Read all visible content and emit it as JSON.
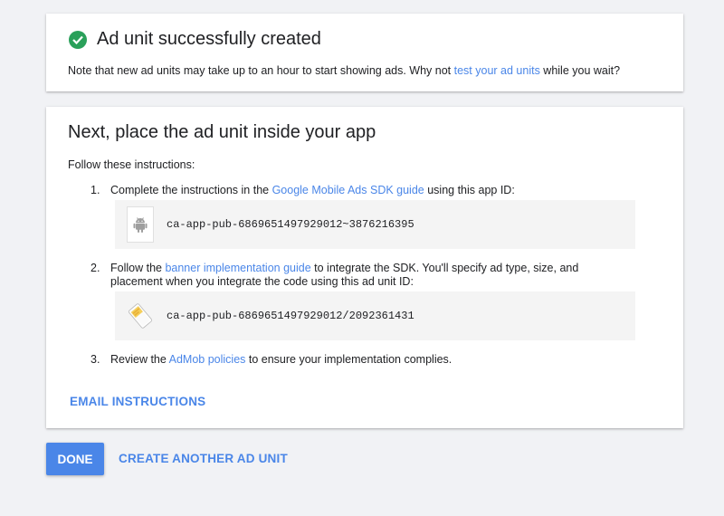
{
  "success_card": {
    "title": "Ad unit successfully created",
    "note_before": "Note that new ad units may take up to an hour to start showing ads.  Why not ",
    "note_link": "test your ad units",
    "note_after": " while you wait?"
  },
  "place_card": {
    "title": "Next, place the ad unit inside your app",
    "follow": "Follow these instructions:",
    "steps": [
      {
        "num": "1.",
        "before": "Complete the instructions in the ",
        "link": "Google Mobile Ads SDK guide",
        "after": " using this app ID:"
      },
      {
        "num": "2.",
        "before": "Follow the ",
        "link": "banner implementation guide",
        "after": " to integrate the SDK. You'll specify ad type, size, and placement when you integrate the code using this ad unit ID:"
      },
      {
        "num": "3.",
        "before": "Review the ",
        "link": "AdMob policies",
        "after": " to ensure your implementation complies."
      }
    ],
    "app_id": "ca-app-pub-6869651497929012~3876216395",
    "ad_unit_id": "ca-app-pub-6869651497929012/2092361431",
    "app_id_icon": "android-icon",
    "ad_unit_icon": "banner-ad-icon",
    "email_label": "EMAIL INSTRUCTIONS"
  },
  "actions": {
    "done_label": "DONE",
    "another_label": "CREATE ANOTHER AD UNIT"
  },
  "colors": {
    "accent": "#4a86e8",
    "success": "#2aa05a",
    "background": "#f1f2f5"
  }
}
